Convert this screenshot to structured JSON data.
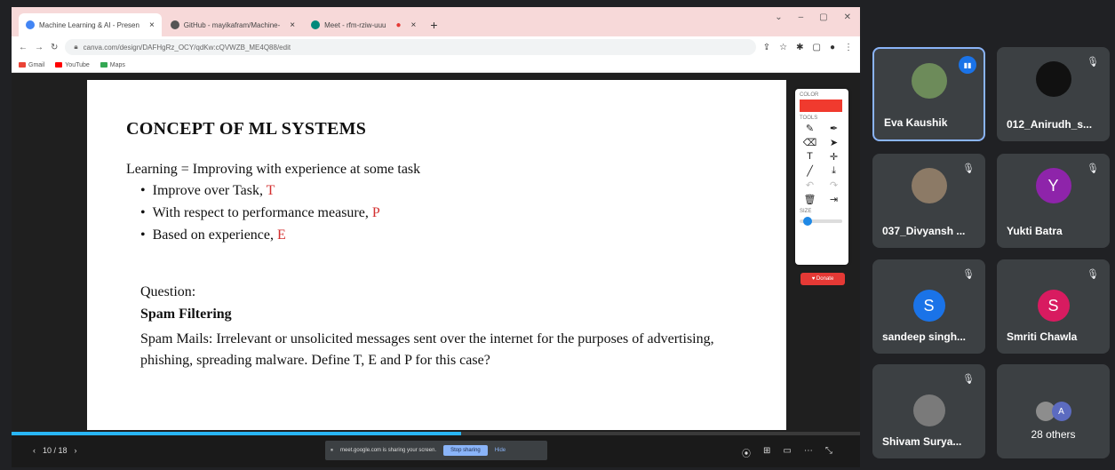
{
  "browser": {
    "tabs": [
      {
        "title": "Machine Learning & AI - Presen",
        "color": "#4285f4",
        "active": true
      },
      {
        "title": "GitHub - mayikafram/Machine-",
        "color": "#f7d9d9",
        "active": false
      },
      {
        "title": "Meet - rfm-rziw-uuu",
        "color": "#00897b",
        "active": false
      }
    ],
    "url": "canva.com/design/DAFHgRz_OCY/qdKw:cQVWZB_ME4Q88/edit",
    "bookmarks": [
      {
        "label": "Gmail",
        "color": "#ea4335"
      },
      {
        "label": "YouTube",
        "color": "#ff0000"
      },
      {
        "label": "Maps",
        "color": "#34a853"
      }
    ]
  },
  "slide": {
    "title": "CONCEPT OF ML SYSTEMS",
    "learning": "Learning = Improving with experience at some task",
    "bullets": [
      {
        "text": "Improve over Task, ",
        "letter": "T"
      },
      {
        "text": "With respect to performance measure, ",
        "letter": "P"
      },
      {
        "text": "Based on experience, ",
        "letter": "E"
      }
    ],
    "question": "Question:",
    "spam_title": "Spam Filtering",
    "spam_desc": "Spam Mails: Irrelevant or unsolicited messages sent over the internet for the purposes of advertising, phishing, spreading malware. Define T, E and P for this case?"
  },
  "toolbar": {
    "color_label": "COLOR",
    "tools_label": "TOOLS",
    "size_label": "SIZE",
    "color": "#f03a2e",
    "donate_label": "♥ Donate"
  },
  "presentation": {
    "page": "10 / 18",
    "progress": 0.53
  },
  "share_notice": {
    "text": "meet.google.com is sharing your screen.",
    "stop_label": "Stop sharing",
    "hide_label": "Hide"
  },
  "participants": [
    {
      "name": "Eva Kaushik",
      "avatar_color": "#6d8b5a",
      "initial": "",
      "speaking": true
    },
    {
      "name": "012_Anirudh_s...",
      "avatar_color": "#111111",
      "initial": ""
    },
    {
      "name": "037_Divyansh ...",
      "avatar_color": "#8c7a66",
      "initial": ""
    },
    {
      "name": "Yukti Batra",
      "avatar_color": "#8e24aa",
      "initial": "Y"
    },
    {
      "name": "sandeep singh...",
      "avatar_color": "#1a73e8",
      "initial": "S"
    },
    {
      "name": "Smriti Chawla",
      "avatar_color": "#d81b60",
      "initial": "S"
    },
    {
      "name": "Shivam Surya...",
      "avatar_color": "#7a7a7a",
      "initial": ""
    }
  ],
  "others": {
    "label": "28 others",
    "initial": "A"
  }
}
